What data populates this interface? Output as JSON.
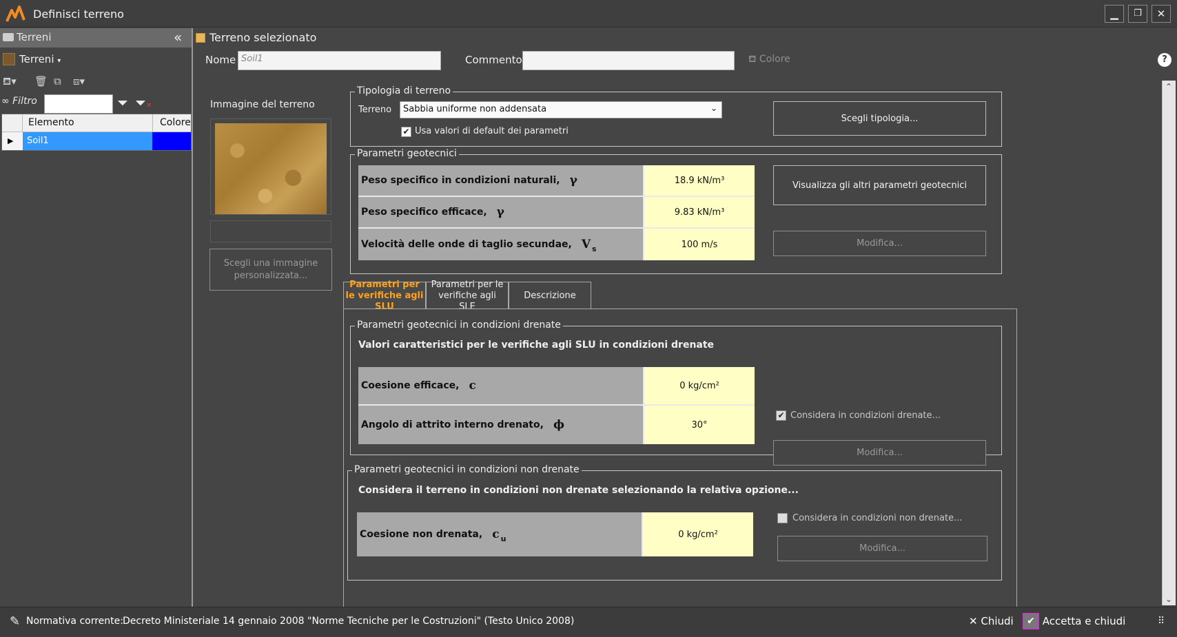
{
  "window": {
    "title": "Definisci terreno",
    "brand_color": "#f08a24"
  },
  "sidebar": {
    "header": "Terreni",
    "dropdown": "Terreni",
    "filter_label": "Filtro",
    "filter_value": "",
    "columns": [
      "Elemento",
      "Colore"
    ],
    "rows": [
      {
        "name": "Soil1",
        "color": "#0000ff"
      }
    ]
  },
  "main": {
    "section_title": "Terreno selezionato",
    "name_label": "Nome",
    "name_value": "Soil1",
    "comment_label": "Commento",
    "comment_value": "",
    "color_label": "Colore",
    "image_label": "Immagine del terreno",
    "choose_image_button": "Scegli una immagine personalizzata...",
    "tipologia": {
      "title": "Tipologia di terreno",
      "terreno_label": "Terreno",
      "terreno_value": "Sabbia uniforme non addensata",
      "default_check_label": "Usa valori di default dei parametri",
      "default_checked": true,
      "choose_button": "Scegli tipologia..."
    },
    "geotech": {
      "title": "Parametri geotecnici",
      "rows": [
        {
          "label": "Peso specifico in condizioni naturali,",
          "symbol": "γ",
          "subscript": "",
          "value": "18.9 kN/m³"
        },
        {
          "label": "Peso specifico efficace,",
          "symbol": "γ",
          "subscript": "",
          "value": "9.83 kN/m³"
        },
        {
          "label": "Velocità delle onde di taglio secundae,",
          "symbol": "V",
          "subscript": "s",
          "value": "100 m/s"
        }
      ],
      "show_button": "Visualizza gli altri parametri geotecnici",
      "modify_button": "Modifica..."
    },
    "tabs": [
      {
        "label": "Parametri per le verifiche agli SLU",
        "active": true
      },
      {
        "label": "Parametri per le verifiche agli SLE",
        "active": false
      },
      {
        "label": "Descrizione",
        "active": false
      }
    ],
    "drained": {
      "title": "Parametri geotecnici in condizioni drenate",
      "heading": "Valori caratteristici per le verifiche agli SLU in condizioni drenate",
      "rows": [
        {
          "label": "Coesione efficace,",
          "symbol": "c",
          "subscript": "",
          "value": "0 kg/cm²"
        },
        {
          "label": "Angolo di attrito interno drenato,",
          "symbol": "ϕ",
          "subscript": "",
          "value": "30°"
        }
      ],
      "check_label": "Considera in condizioni drenate...",
      "checked": true,
      "modify_button": "Modifica..."
    },
    "undrained": {
      "title": "Parametri geotecnici in condizioni non drenate",
      "heading": "Considera il terreno in condizioni non drenate selezionando la relativa opzione...",
      "rows": [
        {
          "label": "Coesione non drenata,",
          "symbol": "c",
          "subscript": "u",
          "value": "0 kg/cm²"
        }
      ],
      "check_label": "Considera in condizioni non drenate...",
      "checked": false,
      "modify_button": "Modifica..."
    }
  },
  "status": {
    "normativa_label": "Normativa corrente:",
    "normativa_value": "Decreto Ministeriale 14 gennaio 2008 \"Norme Tecniche per le Costruzioni\" (Testo Unico 2008)",
    "close_button": "Chiudi",
    "accept_button": "Accetta e chiudi"
  }
}
